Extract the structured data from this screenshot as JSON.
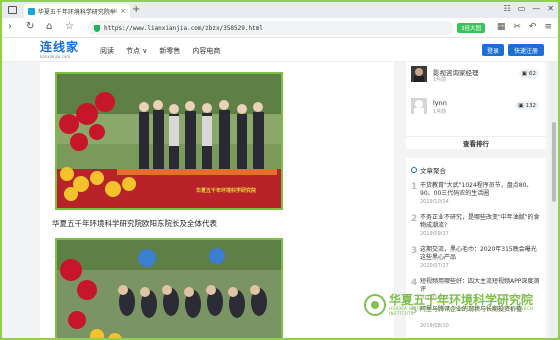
{
  "browser": {
    "tab_title": "华夏五千年环境科学研究院举行...",
    "tab_close": "×",
    "new_tab": "+",
    "address": "https://www.lianxianjia.com/zbzx/358529.html",
    "speed_badge": "3倍大图",
    "window_controls": [
      "☷",
      "▭",
      "—",
      "✕"
    ]
  },
  "site": {
    "logo": "连线家",
    "logo_sub": "lianxianjia.com",
    "nav": [
      "阅读",
      "节点 ∨",
      "新零售",
      "内容电商"
    ],
    "login": "登录",
    "signup": "快速注册"
  },
  "article": {
    "caption": "华夏五千年环境科学研究院欧阳东院长及全体代表",
    "photo_watermark": "华夏五千年环境科学研究院"
  },
  "sidebar": {
    "users": [
      {
        "name": "影视咨询家经理",
        "time": "1月前",
        "count": "62"
      },
      {
        "name": "lynn",
        "time": "1月前",
        "count": "132"
      }
    ],
    "view_rank": "查看排行",
    "recs_title": "文章聚合",
    "recs": [
      {
        "num": "1",
        "title": "干货教育\"大武\"1024程序员节，盘点80、90、00三代码农的生活圈",
        "date": "2019/10/24"
      },
      {
        "num": "2",
        "title": "不务正业不研究，是哪些改变\"中年油腻\"的食物成潮流?",
        "date": "2019/09/27"
      },
      {
        "num": "3",
        "title": "这期交流，黑心毛巾：2020年315晚会曝光这些黑心产品",
        "date": "2020/07/17"
      },
      {
        "num": "4",
        "title": "短视频用哪些好：四大主流短视频APP深度测评",
        "date": "2019/10/26"
      },
      {
        "num": "5",
        "title": "阿里与腾讯企业的现状与长期投资价值",
        "date": "2019/08/10"
      }
    ]
  },
  "watermark": {
    "title": "华夏五千年环境科学研究院",
    "sub": "HUAXIA WUQIANNIAN ENVIRONMENTAL SCIENCE RESEARCH INSTITUTE"
  },
  "colors": {
    "accent": "#1a6ed8",
    "frame_green": "#8fd14f",
    "badge_green": "#39c45a"
  }
}
